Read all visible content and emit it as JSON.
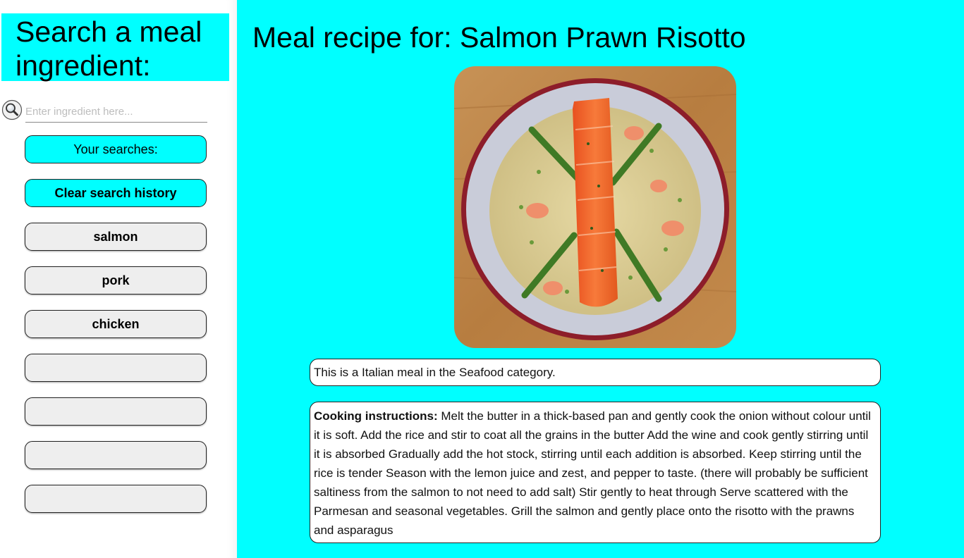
{
  "sidebar": {
    "title": "Search a meal ingredient:",
    "search": {
      "placeholder": "Enter ingredient here...",
      "value": ""
    },
    "your_searches_label": "Your searches:",
    "clear_history_label": "Clear search history",
    "history": [
      "salmon",
      "pork",
      "chicken",
      "",
      "",
      "",
      ""
    ]
  },
  "main": {
    "title": "Meal recipe for: Salmon Prawn Risotto",
    "category_text": "This is a Italian meal in the Seafood category.",
    "instructions_label": "Cooking instructions:",
    "instructions_text": " Melt the butter in a thick-based pan and gently cook the onion without colour until it is soft. Add the rice and stir to coat all the grains in the butter Add the wine and cook gently stirring until it is absorbed Gradually add the hot stock, stirring until each addition is absorbed. Keep stirring until the rice is tender Season with the lemon juice and zest, and pepper to taste. (there will probably be sufficient saltiness from the salmon to not need to add salt) Stir gently to heat through Serve scattered with the Parmesan and seasonal vegetables. Grill the salmon and gently place onto the risotto with the prawns and asparagus"
  },
  "icons": {
    "search": "search-icon"
  },
  "colors": {
    "accent": "#00ffff",
    "button_gray": "#eeeeee",
    "panel": "#ffffff"
  }
}
